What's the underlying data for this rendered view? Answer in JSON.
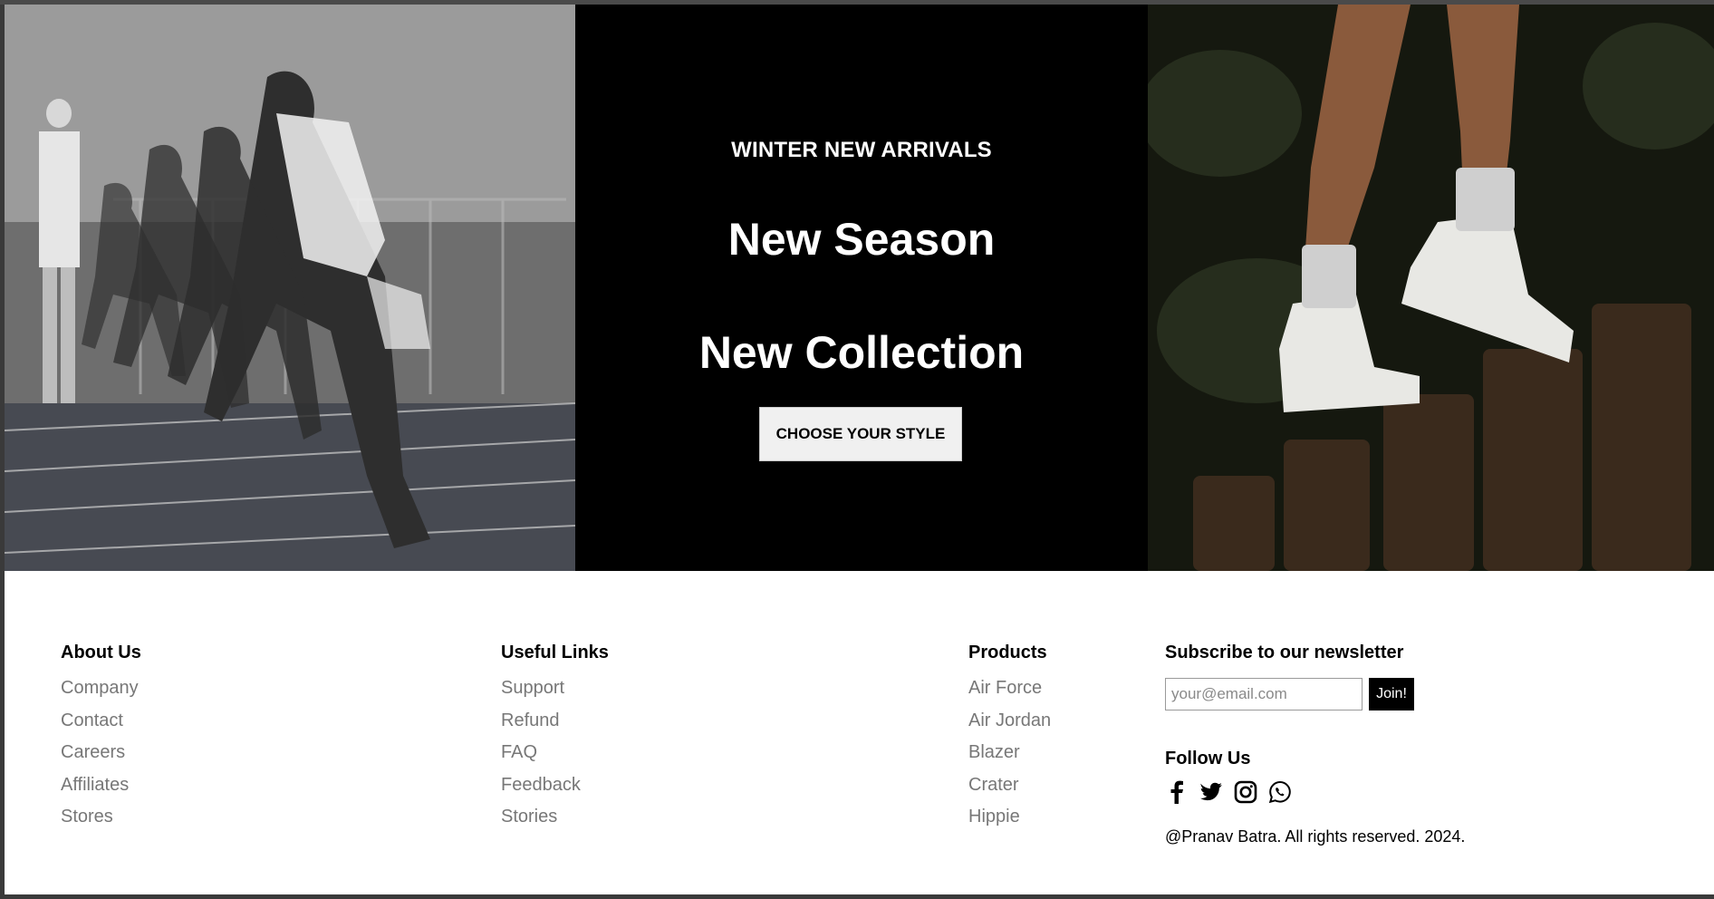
{
  "hero": {
    "eyebrow": "WINTER NEW ARRIVALS",
    "headline_line1": "New Season",
    "headline_line2": "New Collection",
    "cta_label": "CHOOSE YOUR STYLE"
  },
  "footer": {
    "about": {
      "title": "About Us",
      "links": [
        "Company",
        "Contact",
        "Careers",
        "Affiliates",
        "Stores"
      ]
    },
    "useful_links": {
      "title": "Useful Links",
      "links": [
        "Support",
        "Refund",
        "FAQ",
        "Feedback",
        "Stories"
      ]
    },
    "products": {
      "title": "Products",
      "links": [
        "Air Force",
        "Air Jordan",
        "Blazer",
        "Crater",
        "Hippie"
      ]
    },
    "newsletter": {
      "title": "Subscribe to our newsletter",
      "placeholder": "your@email.com",
      "button_label": "Join!"
    },
    "follow": {
      "title": "Follow Us",
      "icons": [
        "facebook-icon",
        "twitter-icon",
        "instagram-icon",
        "whatsapp-icon"
      ]
    },
    "copyright": "@Pranav Batra. All rights reserved. 2024."
  }
}
